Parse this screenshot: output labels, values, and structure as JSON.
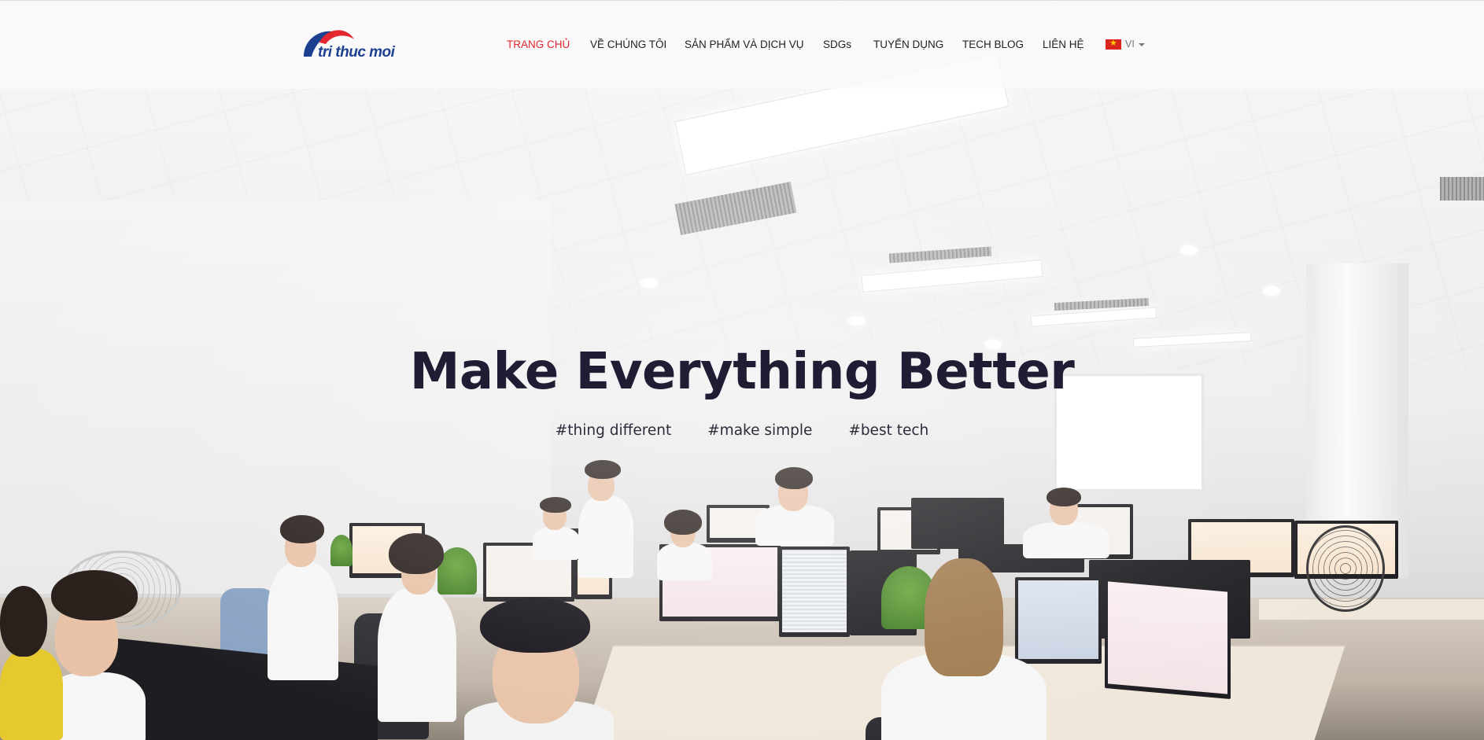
{
  "brand": {
    "logo_text": "tri thuc moi",
    "colors": {
      "blue": "#1c3f8f",
      "red": "#e3262f"
    }
  },
  "nav": {
    "items": [
      {
        "label": "TRANG CHỦ",
        "active": true
      },
      {
        "label": "VỀ CHÚNG TÔI",
        "active": false
      },
      {
        "label": "SẢN PHẨM VÀ DỊCH VỤ",
        "active": false
      },
      {
        "label": "SDGs",
        "active": false
      },
      {
        "label": "TUYỂN DỤNG",
        "active": false
      },
      {
        "label": "TECH BLOG",
        "active": false
      },
      {
        "label": "LIÊN HỆ",
        "active": false
      }
    ],
    "active_color": "#e3262f",
    "text_color": "#222222"
  },
  "language": {
    "flag_icon": "vietnam-flag-icon",
    "label": "VI",
    "dropdown_icon": "chevron-down-icon"
  },
  "hero": {
    "title": "Make Everything Better",
    "hashtags": [
      "#thing different",
      "#make simple",
      "#best tech"
    ],
    "background": "office-photo"
  }
}
